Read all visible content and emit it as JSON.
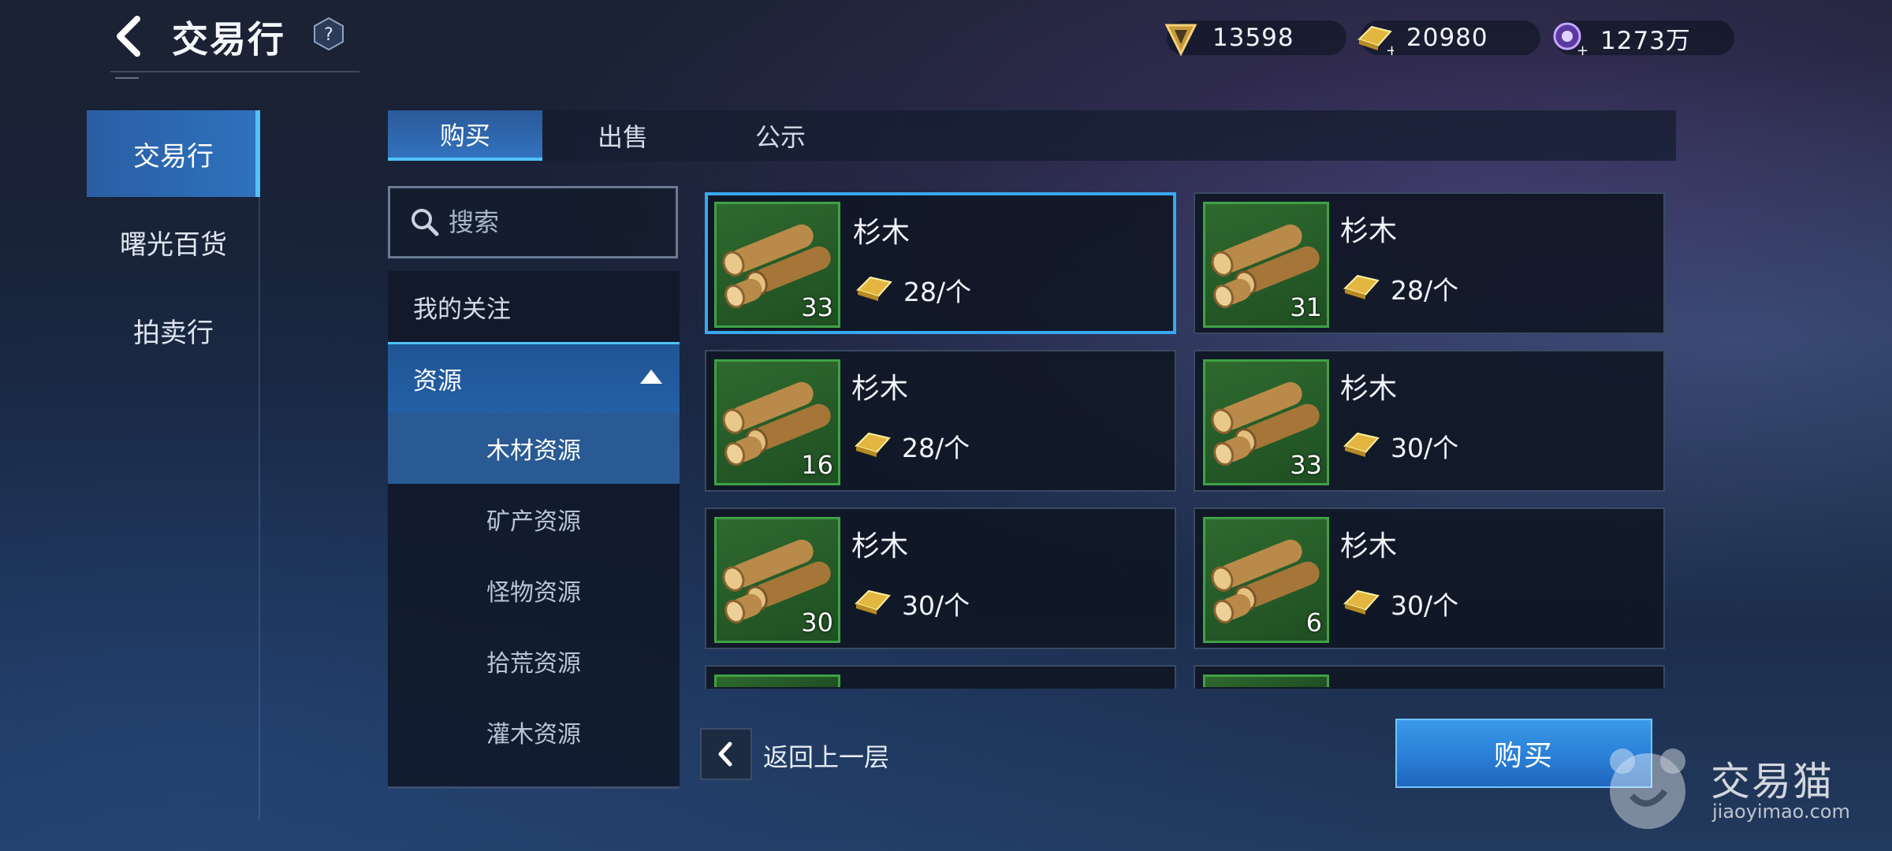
{
  "header": {
    "title": "交易行",
    "help_glyph": "?"
  },
  "currencies": [
    {
      "icon": "energy-crystal-icon",
      "value": "13598"
    },
    {
      "icon": "gold-bar-icon",
      "value": "20980"
    },
    {
      "icon": "purple-gem-icon",
      "value": "1273万"
    }
  ],
  "left_nav": {
    "items": [
      {
        "label": "交易行",
        "active": true
      },
      {
        "label": "曙光百货",
        "active": false
      },
      {
        "label": "拍卖行",
        "active": false
      }
    ]
  },
  "tabs": [
    {
      "label": "购买",
      "active": true
    },
    {
      "label": "出售",
      "active": false
    },
    {
      "label": "公示",
      "active": false
    }
  ],
  "search": {
    "placeholder": "搜索"
  },
  "categories": {
    "favorites": "我的关注",
    "expanded": "资源",
    "sub": [
      "木材资源",
      "矿产资源",
      "怪物资源",
      "拾荒资源",
      "灌木资源"
    ],
    "active_sub": "木材资源"
  },
  "items": [
    {
      "name": "杉木",
      "qty": "33",
      "price": "28/个"
    },
    {
      "name": "杉木",
      "qty": "31",
      "price": "28/个"
    },
    {
      "name": "杉木",
      "qty": "16",
      "price": "28/个"
    },
    {
      "name": "杉木",
      "qty": "33",
      "price": "30/个"
    },
    {
      "name": "杉木",
      "qty": "30",
      "price": "30/个"
    },
    {
      "name": "杉木",
      "qty": "6",
      "price": "30/个"
    }
  ],
  "bottom": {
    "back_label": "返回上一层",
    "buy_label": "购买"
  },
  "watermark": {
    "brand": "交易猫",
    "domain": "jiaoyimao.com"
  }
}
